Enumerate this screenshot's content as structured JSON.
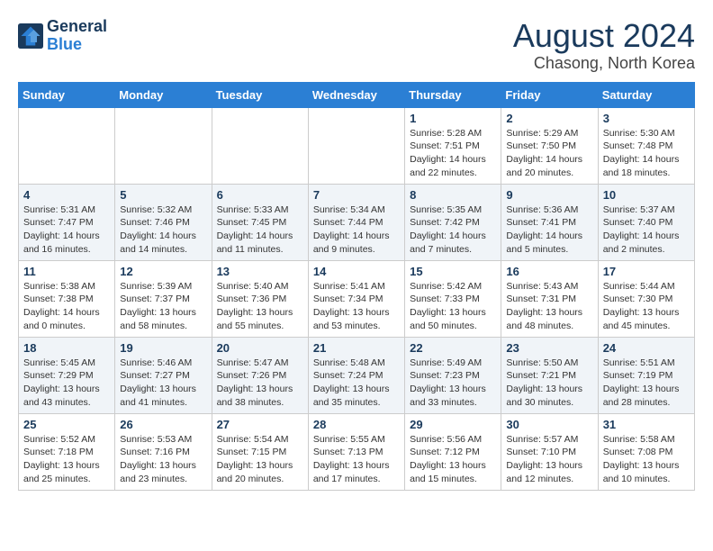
{
  "header": {
    "logo_line1": "General",
    "logo_line2": "Blue",
    "title": "August 2024",
    "subtitle": "Chasong, North Korea"
  },
  "days": [
    "Sunday",
    "Monday",
    "Tuesday",
    "Wednesday",
    "Thursday",
    "Friday",
    "Saturday"
  ],
  "weeks": [
    [
      {
        "day": "",
        "text": ""
      },
      {
        "day": "",
        "text": ""
      },
      {
        "day": "",
        "text": ""
      },
      {
        "day": "",
        "text": ""
      },
      {
        "day": "1",
        "text": "Sunrise: 5:28 AM\nSunset: 7:51 PM\nDaylight: 14 hours\nand 22 minutes."
      },
      {
        "day": "2",
        "text": "Sunrise: 5:29 AM\nSunset: 7:50 PM\nDaylight: 14 hours\nand 20 minutes."
      },
      {
        "day": "3",
        "text": "Sunrise: 5:30 AM\nSunset: 7:48 PM\nDaylight: 14 hours\nand 18 minutes."
      }
    ],
    [
      {
        "day": "4",
        "text": "Sunrise: 5:31 AM\nSunset: 7:47 PM\nDaylight: 14 hours\nand 16 minutes."
      },
      {
        "day": "5",
        "text": "Sunrise: 5:32 AM\nSunset: 7:46 PM\nDaylight: 14 hours\nand 14 minutes."
      },
      {
        "day": "6",
        "text": "Sunrise: 5:33 AM\nSunset: 7:45 PM\nDaylight: 14 hours\nand 11 minutes."
      },
      {
        "day": "7",
        "text": "Sunrise: 5:34 AM\nSunset: 7:44 PM\nDaylight: 14 hours\nand 9 minutes."
      },
      {
        "day": "8",
        "text": "Sunrise: 5:35 AM\nSunset: 7:42 PM\nDaylight: 14 hours\nand 7 minutes."
      },
      {
        "day": "9",
        "text": "Sunrise: 5:36 AM\nSunset: 7:41 PM\nDaylight: 14 hours\nand 5 minutes."
      },
      {
        "day": "10",
        "text": "Sunrise: 5:37 AM\nSunset: 7:40 PM\nDaylight: 14 hours\nand 2 minutes."
      }
    ],
    [
      {
        "day": "11",
        "text": "Sunrise: 5:38 AM\nSunset: 7:38 PM\nDaylight: 14 hours\nand 0 minutes."
      },
      {
        "day": "12",
        "text": "Sunrise: 5:39 AM\nSunset: 7:37 PM\nDaylight: 13 hours\nand 58 minutes."
      },
      {
        "day": "13",
        "text": "Sunrise: 5:40 AM\nSunset: 7:36 PM\nDaylight: 13 hours\nand 55 minutes."
      },
      {
        "day": "14",
        "text": "Sunrise: 5:41 AM\nSunset: 7:34 PM\nDaylight: 13 hours\nand 53 minutes."
      },
      {
        "day": "15",
        "text": "Sunrise: 5:42 AM\nSunset: 7:33 PM\nDaylight: 13 hours\nand 50 minutes."
      },
      {
        "day": "16",
        "text": "Sunrise: 5:43 AM\nSunset: 7:31 PM\nDaylight: 13 hours\nand 48 minutes."
      },
      {
        "day": "17",
        "text": "Sunrise: 5:44 AM\nSunset: 7:30 PM\nDaylight: 13 hours\nand 45 minutes."
      }
    ],
    [
      {
        "day": "18",
        "text": "Sunrise: 5:45 AM\nSunset: 7:29 PM\nDaylight: 13 hours\nand 43 minutes."
      },
      {
        "day": "19",
        "text": "Sunrise: 5:46 AM\nSunset: 7:27 PM\nDaylight: 13 hours\nand 41 minutes."
      },
      {
        "day": "20",
        "text": "Sunrise: 5:47 AM\nSunset: 7:26 PM\nDaylight: 13 hours\nand 38 minutes."
      },
      {
        "day": "21",
        "text": "Sunrise: 5:48 AM\nSunset: 7:24 PM\nDaylight: 13 hours\nand 35 minutes."
      },
      {
        "day": "22",
        "text": "Sunrise: 5:49 AM\nSunset: 7:23 PM\nDaylight: 13 hours\nand 33 minutes."
      },
      {
        "day": "23",
        "text": "Sunrise: 5:50 AM\nSunset: 7:21 PM\nDaylight: 13 hours\nand 30 minutes."
      },
      {
        "day": "24",
        "text": "Sunrise: 5:51 AM\nSunset: 7:19 PM\nDaylight: 13 hours\nand 28 minutes."
      }
    ],
    [
      {
        "day": "25",
        "text": "Sunrise: 5:52 AM\nSunset: 7:18 PM\nDaylight: 13 hours\nand 25 minutes."
      },
      {
        "day": "26",
        "text": "Sunrise: 5:53 AM\nSunset: 7:16 PM\nDaylight: 13 hours\nand 23 minutes."
      },
      {
        "day": "27",
        "text": "Sunrise: 5:54 AM\nSunset: 7:15 PM\nDaylight: 13 hours\nand 20 minutes."
      },
      {
        "day": "28",
        "text": "Sunrise: 5:55 AM\nSunset: 7:13 PM\nDaylight: 13 hours\nand 17 minutes."
      },
      {
        "day": "29",
        "text": "Sunrise: 5:56 AM\nSunset: 7:12 PM\nDaylight: 13 hours\nand 15 minutes."
      },
      {
        "day": "30",
        "text": "Sunrise: 5:57 AM\nSunset: 7:10 PM\nDaylight: 13 hours\nand 12 minutes."
      },
      {
        "day": "31",
        "text": "Sunrise: 5:58 AM\nSunset: 7:08 PM\nDaylight: 13 hours\nand 10 minutes."
      }
    ]
  ]
}
